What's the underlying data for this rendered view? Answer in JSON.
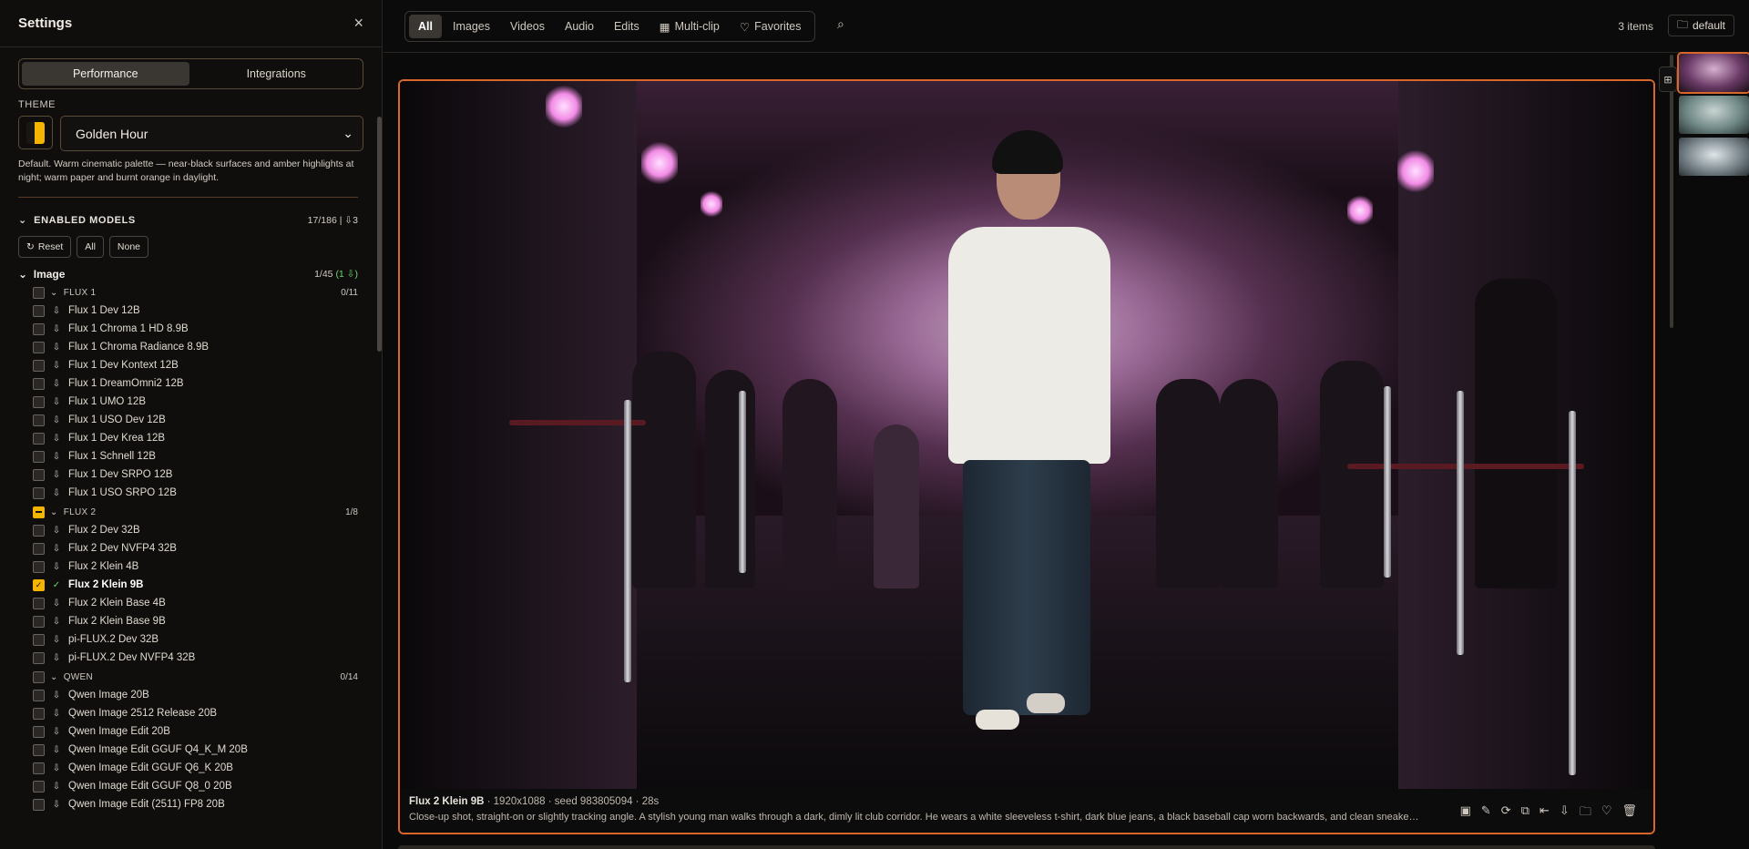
{
  "sidebar": {
    "title": "Settings",
    "close_icon": "×",
    "tabs": [
      {
        "label": "Performance"
      },
      {
        "label": "Integrations"
      }
    ],
    "theme_label": "THEME",
    "theme_value": "Golden Hour",
    "theme_desc": "Default. Warm cinematic palette — near-black surfaces and amber highlights at night; warm paper and burnt orange in daylight.",
    "models_label": "ENABLED MODELS",
    "models_count": "17/186  |  ",
    "models_dl": "⇩3",
    "reset": "Reset",
    "all": "All",
    "none": "None",
    "category": {
      "name": "Image",
      "count": "1/45 ",
      "count_dl": "(1 ⇩)"
    },
    "groups": [
      {
        "name": "FLUX 1",
        "count": "0/11",
        "state": "off",
        "items": [
          "Flux 1 Dev 12B",
          "Flux 1 Chroma 1 HD 8.9B",
          "Flux 1 Chroma Radiance 8.9B",
          "Flux 1 Dev Kontext 12B",
          "Flux 1 DreamOmni2 12B",
          "Flux 1 UMO 12B",
          "Flux 1 USO Dev 12B",
          "Flux 1 Dev Krea 12B",
          "Flux 1 Schnell 12B",
          "Flux 1 Dev SRPO 12B",
          "Flux 1 USO SRPO 12B"
        ]
      },
      {
        "name": "FLUX 2",
        "count": "1/8",
        "state": "partial",
        "items": [
          "Flux 2 Dev 32B",
          "Flux 2 Dev NVFP4 32B",
          "Flux 2 Klein 4B",
          "Flux 2 Klein 9B",
          "Flux 2 Klein Base 4B",
          "Flux 2 Klein Base 9B",
          "pi-FLUX.2 Dev 32B",
          "pi-FLUX.2 Dev NVFP4 32B"
        ],
        "selected": "Flux 2 Klein 9B"
      },
      {
        "name": "QWEN",
        "count": "0/14",
        "state": "off",
        "items": [
          "Qwen Image 20B",
          "Qwen Image 2512 Release 20B",
          "Qwen Image Edit 20B",
          "Qwen Image Edit GGUF Q4_K_M 20B",
          "Qwen Image Edit GGUF Q6_K 20B",
          "Qwen Image Edit GGUF Q8_0 20B",
          "Qwen Image Edit (2511) FP8 20B"
        ]
      }
    ]
  },
  "topbar": {
    "tabs": [
      {
        "label": "All",
        "icon": ""
      },
      {
        "label": "Images",
        "icon": ""
      },
      {
        "label": "Videos",
        "icon": ""
      },
      {
        "label": "Audio",
        "icon": ""
      },
      {
        "label": "Edits",
        "icon": ""
      },
      {
        "label": "Multi-clip",
        "icon": "▦"
      },
      {
        "label": "Favorites",
        "icon": "♡"
      }
    ],
    "search_icon": "⌕",
    "items_count": "3 items",
    "folder_icon": "🗀",
    "folder": "default"
  },
  "viewer": {
    "model": "Flux 2 Klein 9B",
    "meta": " · 1920x1088 · seed 983805094 · 28s",
    "prompt": "Close-up shot, straight-on or slightly tracking angle. A stylish young man walks through a dark, dimly lit club corridor. He wears a white sleeveless t-shirt, dark blue jeans, a black baseball cap worn backwards, and clean sneakers...",
    "actions": [
      {
        "name": "save-icon",
        "glyph": "▣"
      },
      {
        "name": "edit-icon",
        "glyph": "✎"
      },
      {
        "name": "refresh-icon",
        "glyph": "⟳"
      },
      {
        "name": "copy-icon",
        "glyph": "⧉"
      },
      {
        "name": "send-to-start-icon",
        "glyph": "⇤"
      },
      {
        "name": "download-icon",
        "glyph": "⇩"
      },
      {
        "name": "move-folder-icon",
        "glyph": "🗀"
      },
      {
        "name": "favorite-icon",
        "glyph": "♡"
      },
      {
        "name": "delete-icon",
        "glyph": "🗑"
      }
    ]
  },
  "accent": "#d9662a",
  "amber": "#f5b400"
}
